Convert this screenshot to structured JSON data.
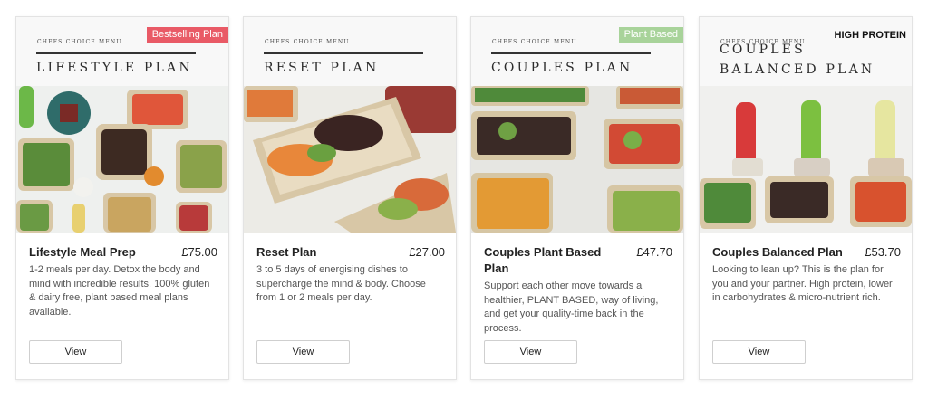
{
  "cards": [
    {
      "menu_eyebrow": "Chefs Choice Menu",
      "menu_title": "LIFESTYLE PLAN",
      "badge": "Bestselling Plan",
      "name": "Lifestyle Meal Prep",
      "price": "£75.00",
      "description": "1-2 meals per day. Detox the body and mind with incredible results. 100% gluten & dairy free, plant based meal plans available.",
      "button": "View"
    },
    {
      "menu_eyebrow": "Chefs Choice Menu",
      "menu_title": "RESET PLAN",
      "badge": "",
      "name": "Reset Plan",
      "price": "£27.00",
      "description": "3 to 5 days of energising dishes to supercharge the mind & body. Choose from 1 or 2 meals per day.",
      "button": "View"
    },
    {
      "menu_eyebrow": "Chefs Choice Menu",
      "menu_title": "COUPLES PLAN",
      "badge": "Plant Based",
      "name": "Couples Plant Based Plan",
      "price": "£47.70",
      "description": "Support each other move towards a healthier, PLANT BASED, way of living, and get your quality-time back in the process.",
      "button": "View"
    },
    {
      "menu_eyebrow": "Chefs Choice Menu",
      "menu_title": "COUPLES BALANCED PLAN",
      "badge": "HIGH PROTEIN",
      "name": "Couples Balanced Plan",
      "price": "£53.70",
      "description": "Looking to lean up? This is the plan for you and your partner. High protein, lower in carbohydrates & micro-nutrient rich.",
      "button": "View"
    }
  ],
  "colors": {
    "badge_red": "#e95a66",
    "badge_green": "#a8d39a",
    "card_border": "#e3e3e3"
  }
}
